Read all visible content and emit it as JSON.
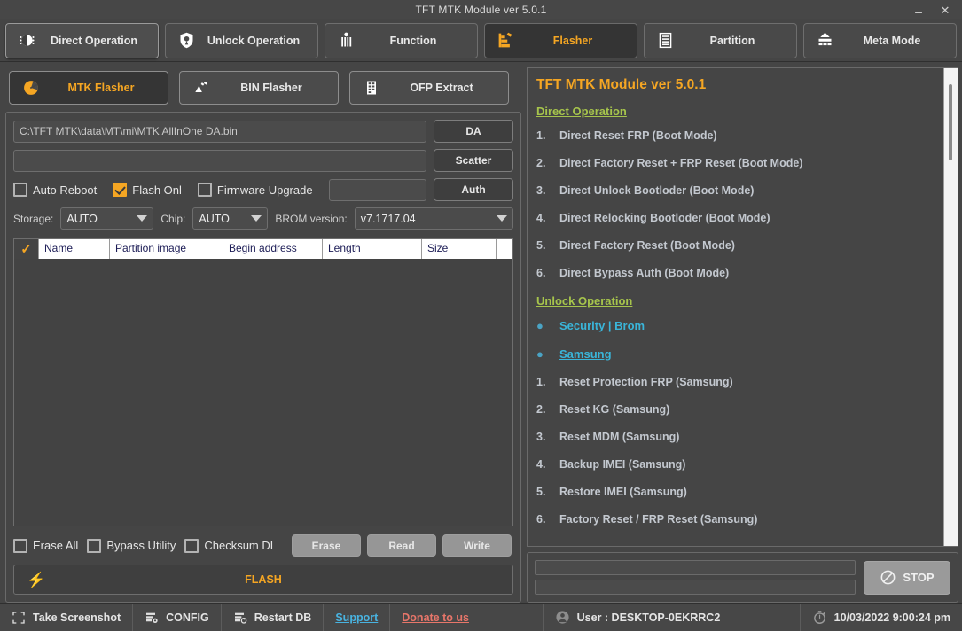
{
  "window": {
    "title": "TFT MTK Module ver 5.0.1",
    "minimize_label": "–",
    "close_label": "✕"
  },
  "main_tabs": [
    {
      "label": "Direct Operation",
      "icon": "cells-icon",
      "state": "raised"
    },
    {
      "label": "Unlock Operation",
      "icon": "unlock-shield-icon",
      "state": "normal"
    },
    {
      "label": "Function",
      "icon": "tools-icon",
      "state": "normal"
    },
    {
      "label": "Flasher",
      "icon": "flasher-icon",
      "state": "active"
    },
    {
      "label": "Partition",
      "icon": "partition-list-icon",
      "state": "normal"
    },
    {
      "label": "Meta Mode",
      "icon": "meta-bricks-icon",
      "state": "normal"
    }
  ],
  "sub_tabs": [
    {
      "label": "MTK Flasher",
      "icon": "pie-chart-icon",
      "state": "active"
    },
    {
      "label": "BIN Flasher",
      "icon": "bin-file-icon",
      "state": "normal"
    },
    {
      "label": "OFP Extract",
      "icon": "extract-film-icon",
      "state": "normal"
    }
  ],
  "flasher": {
    "da_path_value": "C:\\TFT  MTK\\data\\MT\\mi\\MTK  AllInOne  DA.bin",
    "da_path_placeholder": "",
    "da_button": "DA",
    "scatter_value": "",
    "scatter_placeholder": "",
    "scatter_button": "Scatter",
    "auth_value": "",
    "auth_placeholder": "",
    "auth_button": "Auth",
    "checkboxes": [
      {
        "label": "Auto Reboot",
        "checked": false
      },
      {
        "label": "Flash Onl",
        "checked": true
      },
      {
        "label": "Firmware Upgrade",
        "checked": false
      }
    ],
    "storage_label": "Storage:",
    "storage_value": "AUTO",
    "chip_label": "Chip:",
    "chip_value": "AUTO",
    "brom_label": "BROM version:",
    "brom_value": "v7.1717.04",
    "table": {
      "select_all_mark": "✓",
      "columns": [
        "Name",
        "Partition image",
        "Begin address",
        "Length",
        "Size"
      ],
      "rows": []
    },
    "bottom_checkboxes": [
      {
        "label": "Erase All",
        "checked": false
      },
      {
        "label": "Bypass Utility",
        "checked": false
      },
      {
        "label": "Checksum DL",
        "checked": false
      }
    ],
    "action_buttons": [
      "Erase",
      "Read",
      "Write"
    ],
    "flash_button": "FLASH",
    "flash_icon": "⚡"
  },
  "info_panel": {
    "title": "TFT MTK Module ver 5.0.1",
    "sections": [
      {
        "heading": "Direct Operation",
        "bullets": [],
        "items": [
          {
            "n": "1.",
            "text": "Direct Reset FRP (Boot Mode)"
          },
          {
            "n": "2.",
            "text": "Direct Factory Reset + FRP Reset (Boot Mode)"
          },
          {
            "n": "3.",
            "text": "Direct Unlock Bootloder (Boot Mode)"
          },
          {
            "n": "4.",
            "text": "Direct Relocking Bootloder (Boot Mode)"
          },
          {
            "n": "5.",
            "text": "Direct Factory Reset (Boot Mode)"
          },
          {
            "n": "6.",
            "text": "Direct Bypass Auth (Boot Mode)"
          }
        ]
      },
      {
        "heading": "Unlock Operation",
        "bullets": [
          "Security | Brom",
          "Samsung"
        ],
        "items": [
          {
            "n": "1.",
            "text": "Reset Protection FRP (Samsung)"
          },
          {
            "n": "2.",
            "text": "Reset KG (Samsung)"
          },
          {
            "n": "3.",
            "text": "Reset MDM (Samsung)"
          },
          {
            "n": "4.",
            "text": "Backup IMEI (Samsung)"
          },
          {
            "n": "5.",
            "text": "Restore IMEI (Samsung)"
          },
          {
            "n": "6.",
            "text": "Factory Reset / FRP Reset (Samsung)"
          }
        ]
      }
    ]
  },
  "progress": {
    "bar1_value": "",
    "bar2_value": "",
    "stop_label": "STOP",
    "stop_icon": "no-entry-icon"
  },
  "status_bar": {
    "screenshot_label": "Take Screenshot",
    "config_label": "CONFIG",
    "restart_db_label": "Restart DB",
    "support_label": "Support",
    "donate_label": "Donate to us",
    "user_label": "User : DESKTOP-0EKRRC2",
    "datetime": "10/03/2022 9:00:24 pm"
  },
  "colors": {
    "accent_orange": "#f5a623",
    "section_green": "#a6c44c",
    "link_blue": "#3ab5d9",
    "donate_red": "#e8766a",
    "background": "#454545"
  }
}
